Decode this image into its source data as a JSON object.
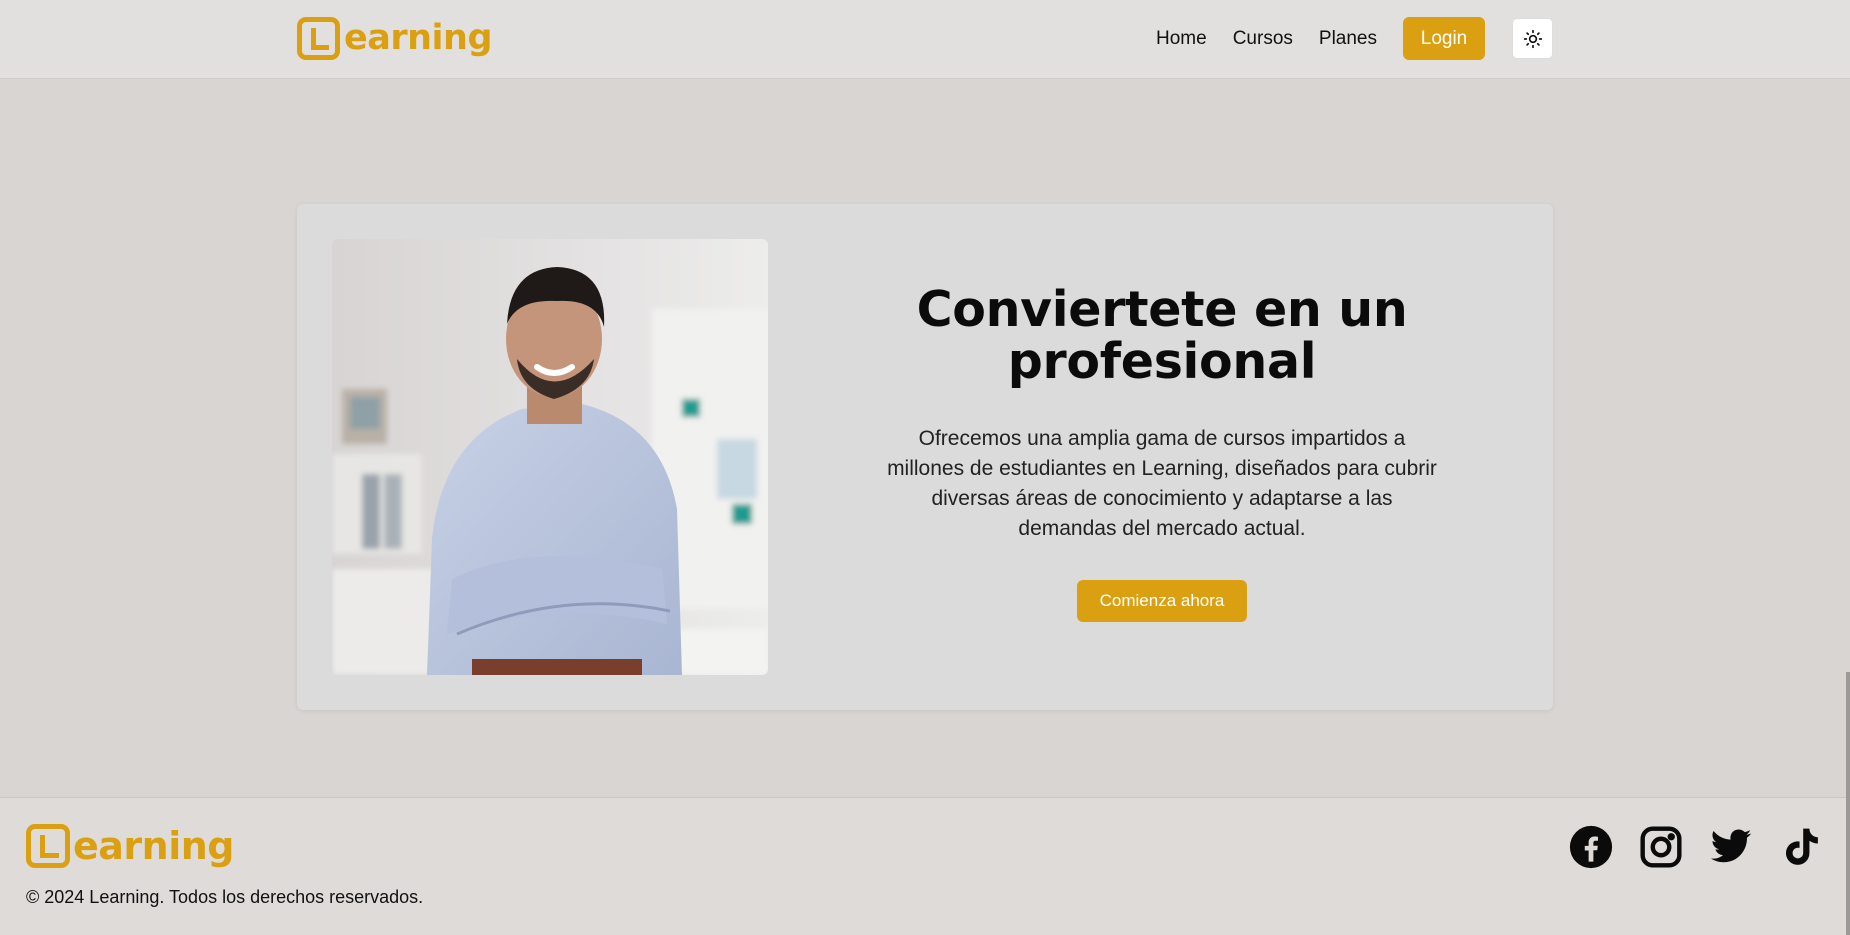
{
  "header": {
    "brand": "earning",
    "nav": [
      "Home",
      "Cursos",
      "Planes"
    ],
    "login_label": "Login",
    "theme_icon": "sun-icon"
  },
  "hero": {
    "title": "Conviertete en un profesional",
    "description": "Ofrecemos una amplia gama de cursos impartidos a millones de estudiantes en Learning, diseñados para cubrir diversas áreas de conocimiento y adaptarse a las demandas del mercado actual.",
    "cta_label": "Comienza ahora",
    "image": "smiling-professional-man-photo"
  },
  "footer": {
    "brand": "earning",
    "copyright": "© 2024 Learning. Todos los derechos reservados.",
    "social": [
      "facebook-icon",
      "instagram-icon",
      "twitter-icon",
      "tiktok-icon"
    ]
  },
  "colors": {
    "accent": "#dba011",
    "background": "#d8d5d2",
    "header": "#e2e0de",
    "card": "#dcdbdb"
  }
}
